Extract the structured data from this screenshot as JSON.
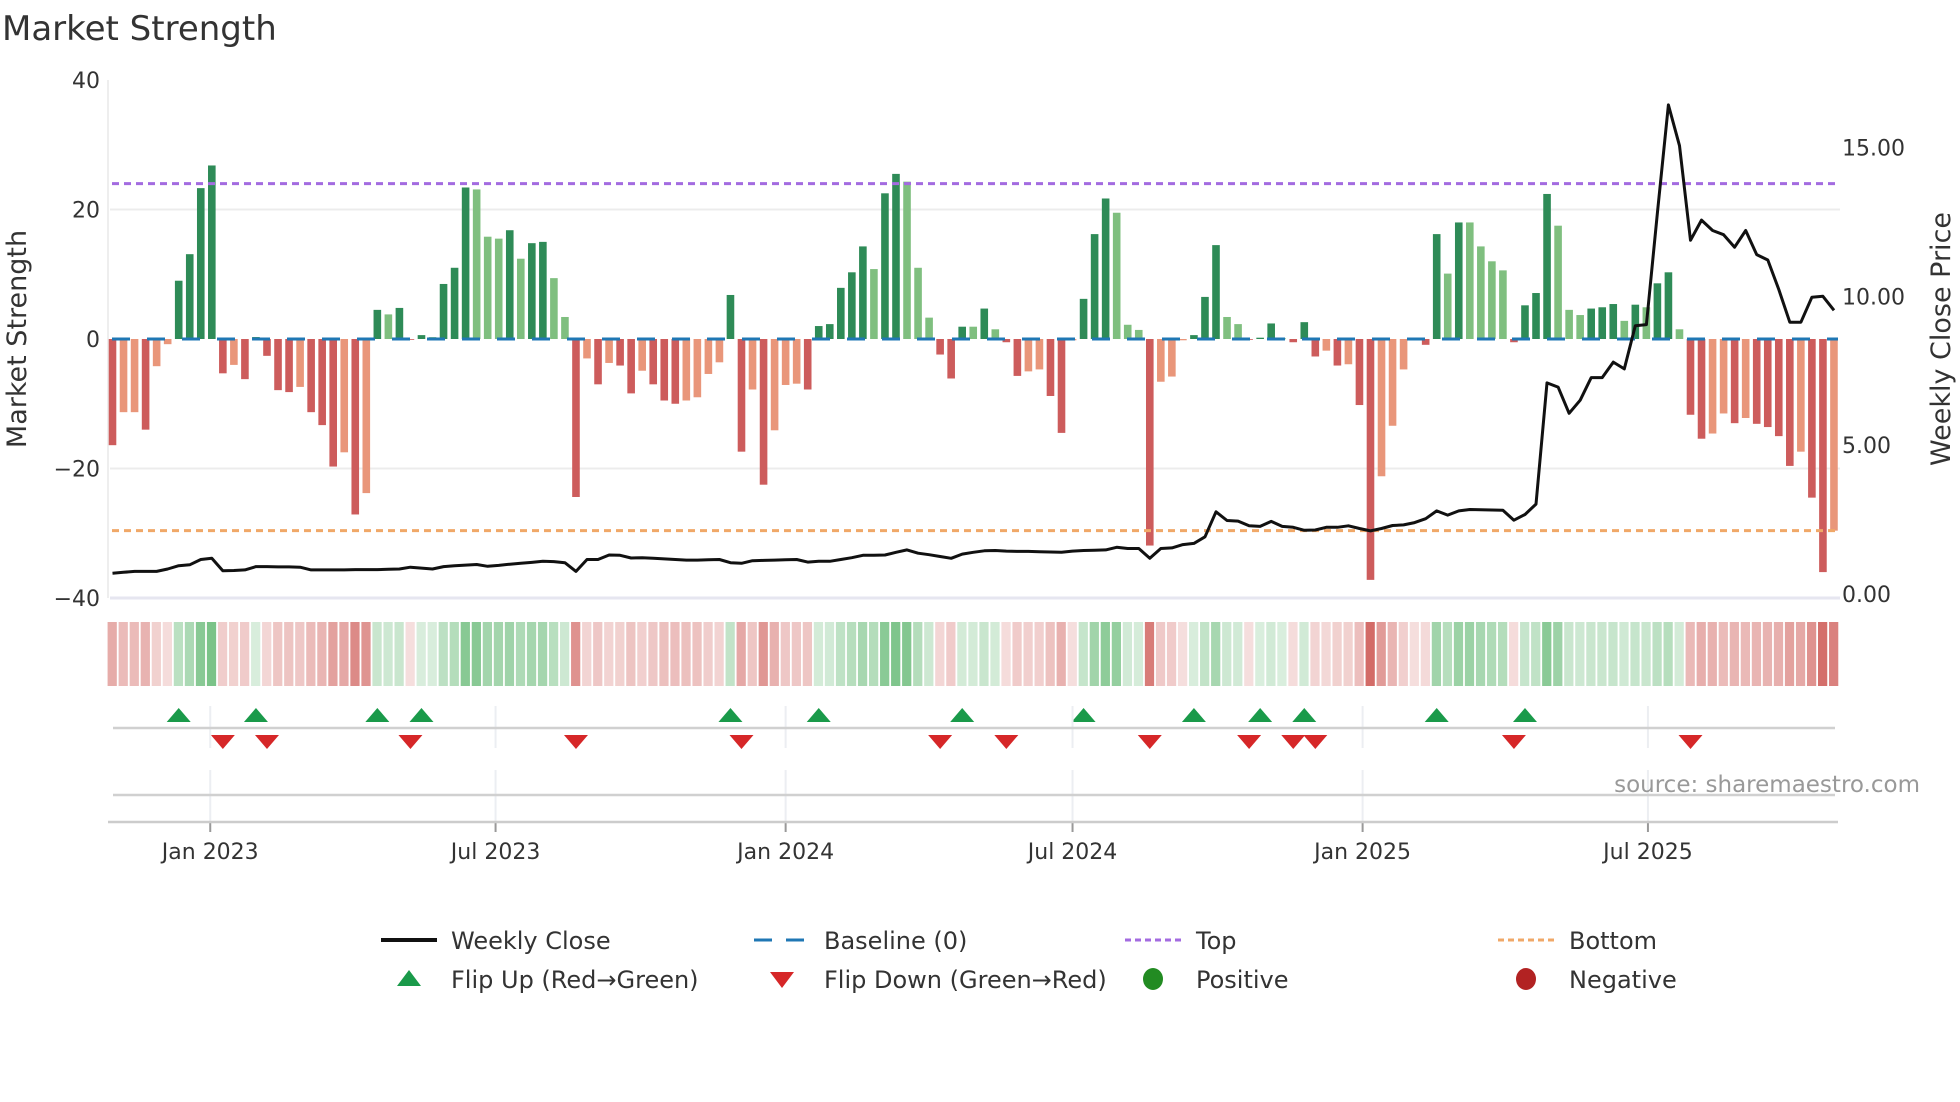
{
  "chart_data": {
    "type": "bar",
    "title": "Market Strength",
    "ylabel": "Market Strength",
    "ylabel_right": "Weekly Close Price",
    "ylim": [
      -40,
      40
    ],
    "ylim_right": [
      0,
      17.3
    ],
    "yticks": [
      "40",
      "20",
      "0",
      "−20",
      "−40"
    ],
    "ytick_values": [
      40,
      20,
      0,
      -20,
      -40
    ],
    "yticks_right": [
      "0.00",
      "5.00",
      "10.00",
      "15.00"
    ],
    "ytick_right_values": [
      0,
      5,
      10,
      15
    ],
    "x_start_date": "2022-10-31",
    "x_frequency": "weekly",
    "xticks": [
      {
        "label": "Jan 2023",
        "date": "2023-01-01"
      },
      {
        "label": "Jul 2023",
        "date": "2023-07-01"
      },
      {
        "label": "Jan 2024",
        "date": "2024-01-01"
      },
      {
        "label": "Jul 2024",
        "date": "2024-07-01"
      },
      {
        "label": "Jan 2025",
        "date": "2025-01-01"
      },
      {
        "label": "Jul 2025",
        "date": "2025-07-01"
      }
    ],
    "top_level": 24,
    "bottom_level": -29.6,
    "grid": true,
    "legend_placement": "bottom-center",
    "series": [
      {
        "name": "Market Strength",
        "type": "bar",
        "values": [
          -16.4,
          -11.3,
          -11.3,
          -14,
          -4.2,
          -0.8,
          9,
          13.1,
          23.3,
          26.8,
          -5.3,
          -4,
          -6.2,
          0.3,
          -2.6,
          -7.9,
          -8.2,
          -7.4,
          -11.3,
          -13.3,
          -19.7,
          -17.5,
          -27.1,
          -23.8,
          4.5,
          3.8,
          4.8,
          -0.1,
          0.6,
          0.3,
          8.5,
          11,
          23.4,
          23.1,
          15.8,
          15.5,
          16.8,
          12.4,
          14.8,
          15,
          9.4,
          3.4,
          -24.4,
          -3,
          -7,
          -3.7,
          -4.1,
          -8.4,
          -4.9,
          -7,
          -9.5,
          -10,
          -9.5,
          -9,
          -5.4,
          -3.6,
          6.8,
          -17.4,
          -7.8,
          -22.5,
          -14.1,
          -7.1,
          -6.9,
          -7.8,
          2,
          2.3,
          7.9,
          10.3,
          14.3,
          10.8,
          22.5,
          25.5,
          24.3,
          11,
          3.3,
          -2.4,
          -6.1,
          1.9,
          1.9,
          4.7,
          1.5,
          -0.5,
          -5.7,
          -5,
          -4.7,
          -8.8,
          -14.5,
          -0.2,
          6.2,
          16.2,
          21.7,
          19.5,
          2.2,
          1.4,
          -31.9,
          -6.6,
          -5.8,
          -0.2,
          0.6,
          6.5,
          14.5,
          3.4,
          2.3,
          -0.1,
          0.2,
          2.4,
          0.1,
          -0.5,
          2.6,
          -2.7,
          -1.8,
          -4.1,
          -3.9,
          -10.2,
          -37.2,
          -21.2,
          -13.4,
          -4.7,
          -0.1,
          -0.9,
          16.2,
          10.1,
          18,
          18,
          14.3,
          12,
          10.6,
          -0.5,
          5.2,
          7.1,
          22.4,
          17.5,
          4.5,
          3.7,
          4.7,
          4.9,
          5.4,
          2.8,
          5.3,
          4.9,
          8.6,
          10.3,
          1.5,
          -11.7,
          -15.4,
          -14.6,
          -11.5,
          -13,
          -12.2,
          -13.1,
          -13.6,
          -15,
          -19.6,
          -17.4,
          -24.5,
          -36,
          -29.6
        ]
      },
      {
        "name": "Weekly Close",
        "type": "line",
        "axis": "right",
        "values": [
          0.7,
          0.73,
          0.76,
          0.76,
          0.76,
          0.84,
          0.95,
          0.98,
          1.16,
          1.2,
          0.78,
          0.79,
          0.81,
          0.92,
          0.92,
          0.91,
          0.91,
          0.9,
          0.81,
          0.81,
          0.81,
          0.81,
          0.82,
          0.82,
          0.82,
          0.83,
          0.84,
          0.9,
          0.87,
          0.84,
          0.92,
          0.95,
          0.97,
          0.99,
          0.93,
          0.96,
          1.0,
          1.03,
          1.06,
          1.1,
          1.09,
          1.05,
          0.76,
          1.16,
          1.16,
          1.31,
          1.3,
          1.21,
          1.22,
          1.2,
          1.18,
          1.16,
          1.14,
          1.14,
          1.15,
          1.16,
          1.05,
          1.03,
          1.12,
          1.13,
          1.14,
          1.15,
          1.16,
          1.07,
          1.1,
          1.1,
          1.16,
          1.22,
          1.3,
          1.3,
          1.31,
          1.4,
          1.48,
          1.37,
          1.32,
          1.26,
          1.2,
          1.34,
          1.4,
          1.45,
          1.46,
          1.44,
          1.43,
          1.43,
          1.42,
          1.41,
          1.4,
          1.44,
          1.46,
          1.47,
          1.48,
          1.57,
          1.53,
          1.53,
          1.2,
          1.53,
          1.55,
          1.66,
          1.7,
          1.92,
          2.76,
          2.47,
          2.45,
          2.29,
          2.27,
          2.44,
          2.27,
          2.24,
          2.14,
          2.15,
          2.24,
          2.24,
          2.29,
          2.2,
          2.12,
          2.2,
          2.3,
          2.32,
          2.4,
          2.53,
          2.79,
          2.65,
          2.79,
          2.84,
          2.83,
          2.82,
          2.81,
          2.48,
          2.67,
          3.02,
          7.09,
          6.95,
          6.07,
          6.51,
          7.27,
          7.27,
          7.79,
          7.56,
          9.01,
          9.05,
          12.8,
          16.43,
          15.06,
          11.88,
          12.56,
          12.21,
          12.07,
          11.65,
          12.21,
          11.4,
          11.22,
          10.23,
          9.13,
          9.13,
          9.97,
          10.0,
          9.53
        ]
      }
    ],
    "legend": [
      {
        "label": "Weekly Close",
        "symbol": "line",
        "color": "#111111"
      },
      {
        "label": "Baseline (0)",
        "symbol": "dashed",
        "color": "#1f77b4"
      },
      {
        "label": "Top",
        "symbol": "dotted",
        "color": "#a36be0"
      },
      {
        "label": "Bottom",
        "symbol": "dotted",
        "color": "#f0a868"
      },
      {
        "label": "Flip Up (Red→Green)",
        "symbol": "triangle-up",
        "color": "#1a9a4a"
      },
      {
        "label": "Flip Down (Green→Red)",
        "symbol": "triangle-down",
        "color": "#d62728"
      },
      {
        "label": "Positive",
        "symbol": "dot",
        "color": "#228b22"
      },
      {
        "label": "Negative",
        "symbol": "dot",
        "color": "#b22222"
      }
    ],
    "colors": {
      "pos_rising": "#2e8b57",
      "pos_falling": "#7fbf7f",
      "neg_falling": "#cd5c5c",
      "neg_rising": "#e9967a"
    },
    "source": "source: sharemaestro.com"
  }
}
